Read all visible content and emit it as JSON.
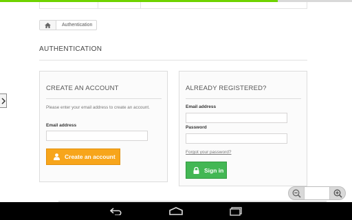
{
  "progress": {
    "fraction": 0.79
  },
  "breadcrumb": {
    "home_icon": "home-icon",
    "current": "Authentication"
  },
  "page": {
    "title": "AUTHENTICATION"
  },
  "create_account": {
    "heading": "CREATE AN ACCOUNT",
    "intro": "Please enter your email address to create an account.",
    "email_label": "Email address",
    "email_value": "",
    "button_label": "Create an account",
    "button_icon": "user-icon"
  },
  "login": {
    "heading": "ALREADY REGISTERED?",
    "email_label": "Email address",
    "email_value": "",
    "password_label": "Password",
    "password_value": "",
    "forgot_link": "Forgot your password?",
    "button_label": "Sign in",
    "button_icon": "lock-icon"
  },
  "zoom_controls": {
    "zoom_out_icon": "zoom-out-icon",
    "zoom_in_icon": "zoom-in-icon"
  },
  "android_nav": {
    "back_icon": "back-icon",
    "home_icon": "home-outline-icon",
    "recents_icon": "recents-icon"
  },
  "colors": {
    "progress": "#6fd300",
    "create_button": "#f7a51b",
    "signin_button": "#43b754",
    "navbar": "#000000"
  }
}
